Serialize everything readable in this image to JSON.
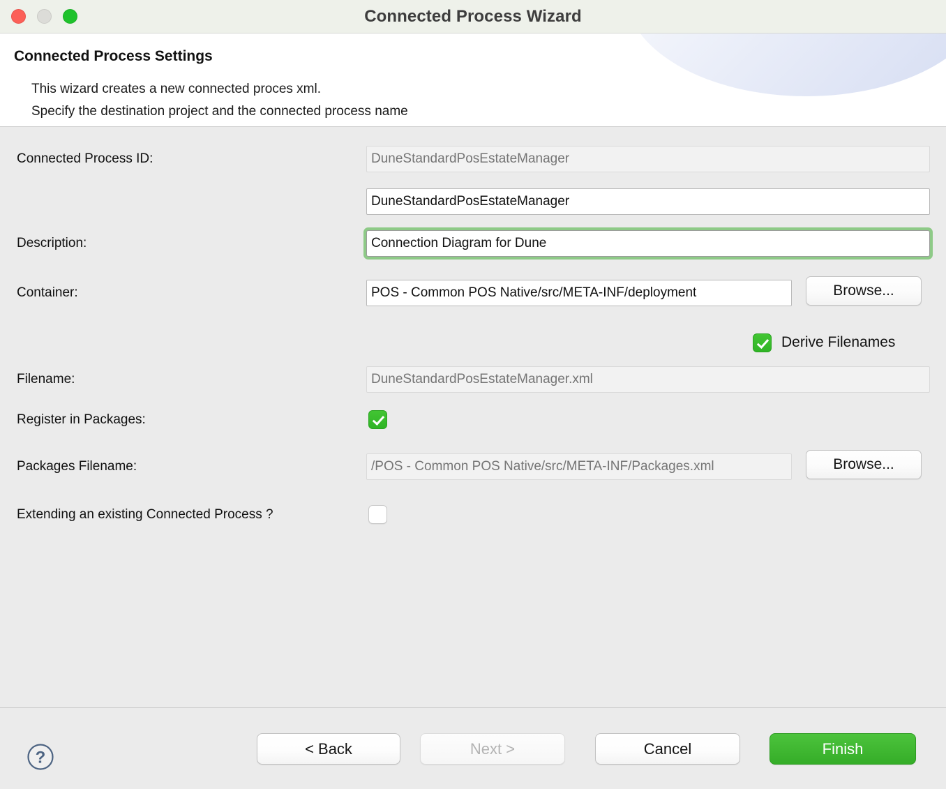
{
  "window": {
    "title": "Connected Process Wizard",
    "traffic_lights": [
      "close",
      "minimize",
      "zoom"
    ]
  },
  "header": {
    "title": "Connected Process Settings",
    "description": "This wizard creates a new connected proces xml.\nSpecify the destination project and the connected process name"
  },
  "form": {
    "process_id": {
      "label": "Connected Process ID:",
      "value": "",
      "placeholder": "DuneStandardPosEstateManager",
      "readonly": true
    },
    "process_name": {
      "label": "",
      "value": "DuneStandardPosEstateManager",
      "placeholder": "",
      "readonly": false
    },
    "description": {
      "label": "Description:",
      "value": "Connection Diagram for Dune",
      "placeholder": "",
      "readonly": false,
      "focused": true
    },
    "container": {
      "label": "Container:",
      "value": "POS - Common POS Native/src/META-INF/deployment",
      "placeholder": "",
      "readonly": false,
      "browse_label": "Browse..."
    },
    "derive_filenames": {
      "label": "Derive Filenames",
      "checked": true
    },
    "filename": {
      "label": "Filename:",
      "value": "",
      "placeholder": "DuneStandardPosEstateManager.xml",
      "readonly": true
    },
    "register_in_packages": {
      "label": "Register in Packages:",
      "checked": true
    },
    "packages_filename": {
      "label": "Packages Filename:",
      "value": "",
      "placeholder": "/POS - Common POS Native/src/META-INF/Packages.xml",
      "readonly": true,
      "browse_label": "Browse..."
    },
    "extending_existing": {
      "label": "Extending an existing Connected Process ?",
      "checked": false
    }
  },
  "footer": {
    "help_label": "?",
    "back_label": "< Back",
    "next_label": "Next >",
    "cancel_label": "Cancel",
    "finish_label": "Finish"
  },
  "colors": {
    "accent_green": "#3bb92e",
    "focus_ring": "#7ec476",
    "titlebar_bg": "#eef1ea",
    "body_bg": "#ebebeb",
    "header_bg": "#ffffff"
  }
}
